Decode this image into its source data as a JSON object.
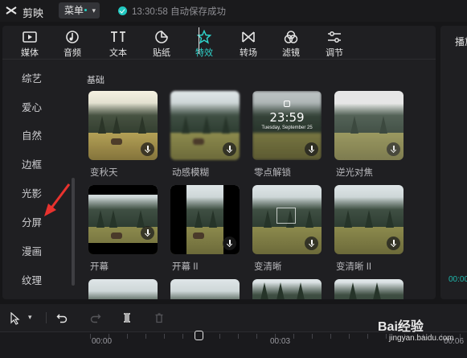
{
  "app": {
    "name": "剪映",
    "menu_label": "菜单",
    "save_status": "13:30:58 自动保存成功"
  },
  "toolbar": {
    "items": [
      {
        "label": "媒体",
        "icon": "media-icon"
      },
      {
        "label": "音频",
        "icon": "audio-icon"
      },
      {
        "label": "文本",
        "icon": "text-icon"
      },
      {
        "label": "贴纸",
        "icon": "sticker-icon"
      },
      {
        "label": "特效",
        "icon": "effects-icon",
        "active": true
      },
      {
        "label": "转场",
        "icon": "transition-icon"
      },
      {
        "label": "滤镜",
        "icon": "filter-icon"
      },
      {
        "label": "调节",
        "icon": "adjust-icon"
      }
    ]
  },
  "sidebar": {
    "items": [
      "综艺",
      "爱心",
      "自然",
      "边框",
      "光影",
      "分屏",
      "漫画",
      "纹理"
    ]
  },
  "section": {
    "title": "基础"
  },
  "effects": [
    {
      "label": "变秋天"
    },
    {
      "label": "动感模糊"
    },
    {
      "label": "零点解锁",
      "clock": "23:59",
      "date": "Tuesday, September 25"
    },
    {
      "label": "逆光对焦"
    },
    {
      "label": "开幕"
    },
    {
      "label": "开幕 II"
    },
    {
      "label": "变清晰"
    },
    {
      "label": "变清晰 II"
    }
  ],
  "right_panel": {
    "title": "播放",
    "time": "00:00"
  },
  "timeline": {
    "ticks": [
      "00:00",
      "00:03",
      "00:06"
    ]
  },
  "watermark": {
    "brand": "Bai经验",
    "url": "jingyan.baidu.com"
  },
  "colors": {
    "accent": "#2fd1c9",
    "annotation_arrow": "#e8322e"
  }
}
